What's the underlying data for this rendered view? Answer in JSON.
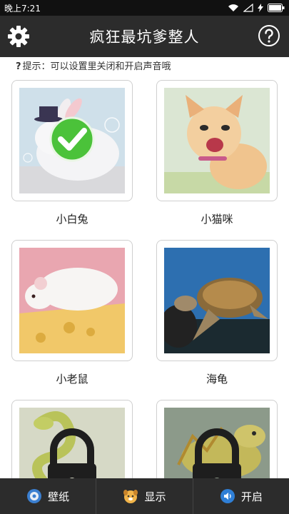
{
  "status": {
    "time": "晚上7:21"
  },
  "header": {
    "title": "疯狂最坑爹整人"
  },
  "hint": {
    "mark": "?",
    "text": "提示：可以设置里关闭和开启声音哦"
  },
  "cards": [
    {
      "label": "小白兔",
      "selected": true,
      "locked": false
    },
    {
      "label": "小猫咪",
      "selected": false,
      "locked": false
    },
    {
      "label": "小老鼠",
      "selected": false,
      "locked": false
    },
    {
      "label": "海龟",
      "selected": false,
      "locked": false
    },
    {
      "label": "",
      "selected": false,
      "locked": true
    },
    {
      "label": "",
      "selected": false,
      "locked": true
    }
  ],
  "tabs": [
    {
      "label": "壁纸",
      "icon": "wallpaper-gear-icon"
    },
    {
      "label": "显示",
      "icon": "dog-face-icon"
    },
    {
      "label": "开启",
      "icon": "speaker-icon"
    }
  ],
  "colors": {
    "header_bg": "#2c2c2c",
    "check_green": "#4bc23a",
    "lock_dark": "#1e1e1e"
  }
}
